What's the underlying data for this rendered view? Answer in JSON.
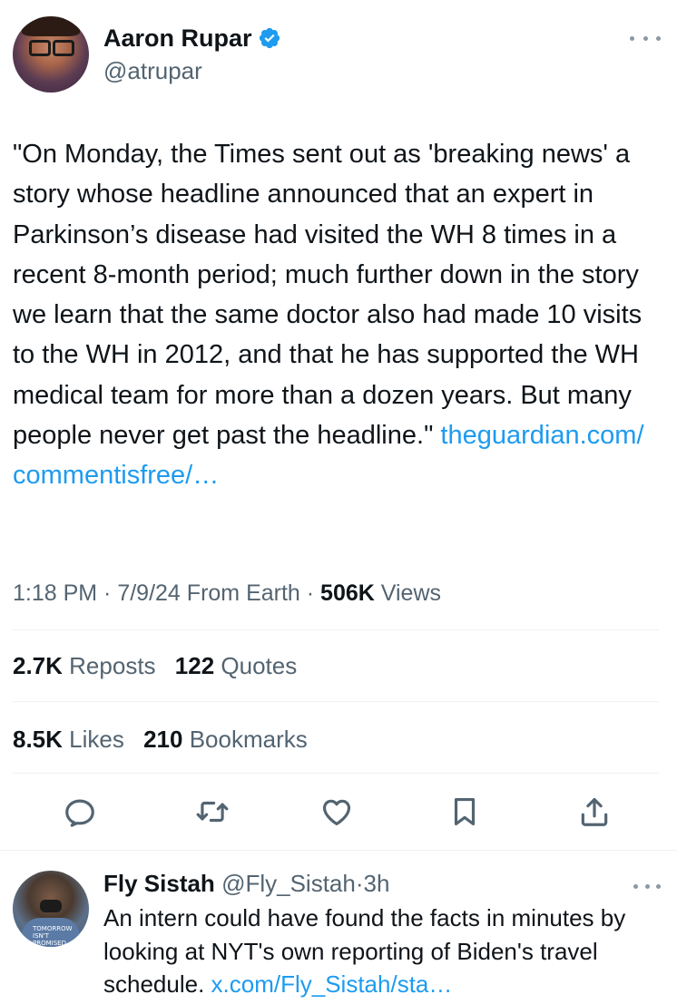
{
  "tweet": {
    "author": {
      "display_name": "Aaron Rupar",
      "handle": "@atrupar",
      "verified": true
    },
    "text": "\"On Monday, the Times sent out as 'breaking news' a story whose headline announced that an expert in Parkinson’s disease had visited the WH 8 times in a recent 8-month period; much further down in the story we learn that the same doctor also had made 10 visits to the WH in 2012, and that he has supported the WH medical team for more than a dozen years. But many people never get past the headline.\" ",
    "link_text": "theguardian.com/\ncommentisfree/…",
    "time": "1:18 PM",
    "date": "7/9/24",
    "source": "From Earth",
    "views_count": "506K",
    "views_label": "Views",
    "reposts_count": "2.7K",
    "reposts_label": "Reposts",
    "quotes_count": "122",
    "quotes_label": "Quotes",
    "likes_count": "8.5K",
    "likes_label": "Likes",
    "bookmarks_count": "210",
    "bookmarks_label": "Bookmarks"
  },
  "actions": {
    "icons": [
      "reply-icon",
      "repost-icon",
      "like-icon",
      "bookmark-icon",
      "share-icon"
    ]
  },
  "reply": {
    "display_name": "Fly Sistah",
    "handle": "@Fly_Sistah",
    "separator": "·",
    "time": "3h",
    "text": "An intern could have found the facts in minutes by looking at NYT's own reporting of Biden's travel schedule. ",
    "link_text": "x.com/Fly_Sistah/sta…",
    "avatar_text": "TOMORROW ISN'T PROMISED LESS THEN ANY"
  },
  "colors": {
    "text": "#0f1419",
    "secondary": "#536471",
    "link": "#1d9bf0",
    "divider": "#eff3f4",
    "verified": "#1d9bf0"
  }
}
